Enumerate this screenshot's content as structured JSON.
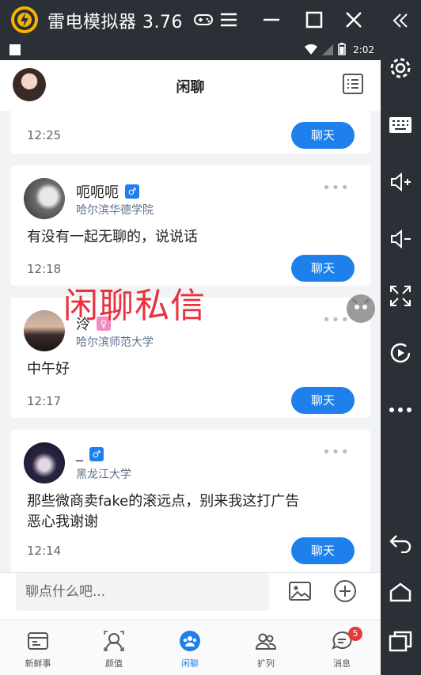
{
  "emulator": {
    "title": "雷电模拟器 3.76",
    "time": "2:02"
  },
  "app": {
    "title": "闲聊"
  },
  "cards": [
    {
      "time": "12:25",
      "button": "聊天"
    },
    {
      "name": "呃呃呃",
      "gender": "male",
      "gender_symbol": "♂",
      "school": "哈尔滨华德学院",
      "text": "有没有一起无聊的，说说话",
      "time": "12:18",
      "button": "聊天"
    },
    {
      "name": "泠",
      "gender": "female",
      "gender_symbol": "♀",
      "school": "哈尔滨师范大学",
      "text": "中午好",
      "time": "12:17",
      "button": "聊天"
    },
    {
      "name": "_",
      "gender": "male",
      "gender_symbol": "♂",
      "school": "黑龙江大学",
      "text_line1": "那些微商卖fake的滚远点，别来我这打广告",
      "text_line2": "恶心我谢谢",
      "time": "12:14",
      "button": "聊天"
    }
  ],
  "more_symbol": "•••",
  "overlay_text": "闲聊私信",
  "input": {
    "placeholder": "聊点什么吧..."
  },
  "tabs": [
    {
      "label": "新鲜事"
    },
    {
      "label": "颜值"
    },
    {
      "label": "闲聊"
    },
    {
      "label": "扩列"
    },
    {
      "label": "消息",
      "badge": "5"
    }
  ],
  "colors": {
    "accent": "#1e80ea",
    "overlay": "#e8323e",
    "badge": "#e63a3a"
  }
}
